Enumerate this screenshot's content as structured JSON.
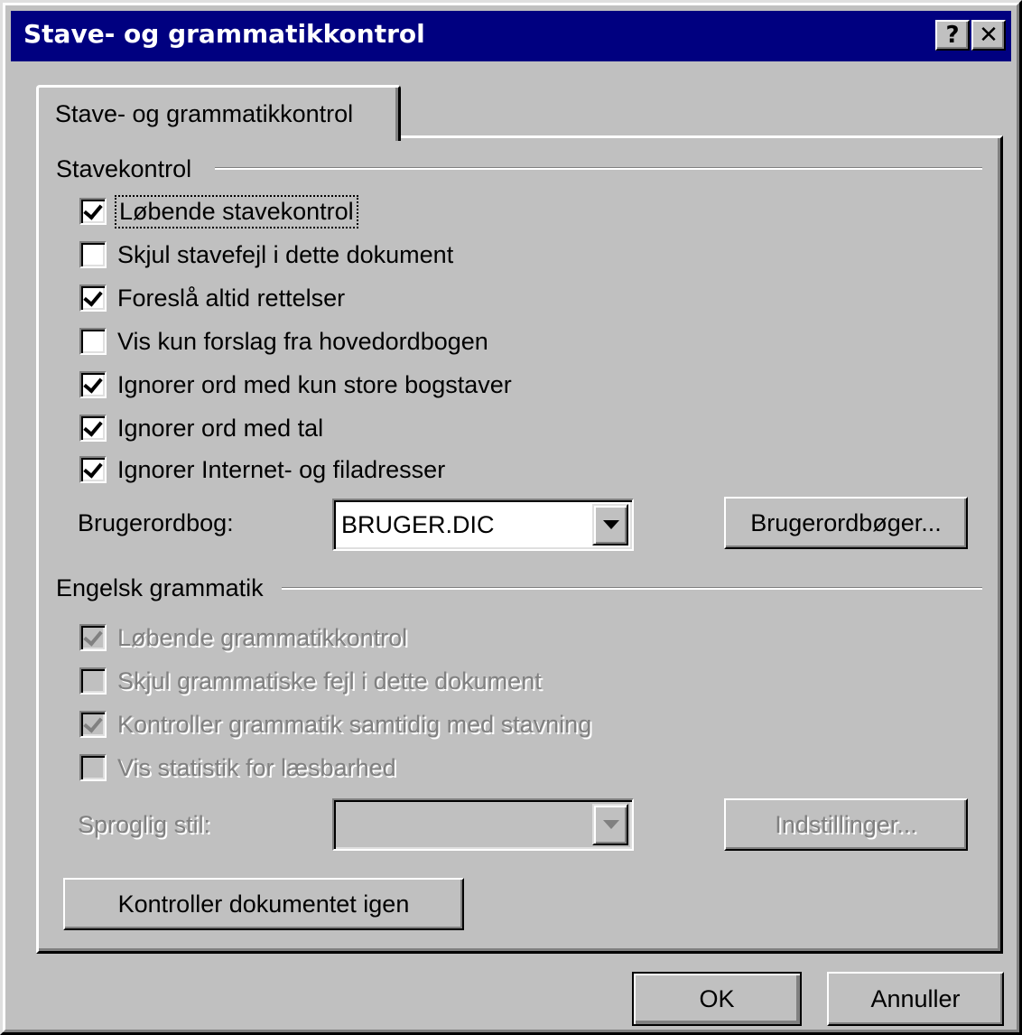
{
  "window": {
    "title": "Stave- og grammatikkontrol",
    "help_glyph": "?",
    "close_glyph": "✕"
  },
  "tab": {
    "label": "Stave- og grammatikkontrol"
  },
  "spelling": {
    "group_label": "Stavekontrol",
    "options": [
      {
        "label": "Løbende stavekontrol",
        "checked": true
      },
      {
        "label": "Skjul stavefejl i dette dokument",
        "checked": false
      },
      {
        "label": "Foreslå altid rettelser",
        "checked": true
      },
      {
        "label": "Vis kun forslag fra hovedordbogen",
        "checked": false
      },
      {
        "label": "Ignorer ord med kun store bogstaver",
        "checked": true
      },
      {
        "label": "Ignorer ord med tal",
        "checked": true
      },
      {
        "label": "Ignorer Internet- og filadresser",
        "checked": true
      }
    ],
    "dictionary_label": "Brugerordbog:",
    "dictionary_value": "BRUGER.DIC",
    "dictionaries_button": "Brugerordbøger..."
  },
  "grammar": {
    "group_label": "Engelsk grammatik",
    "options": [
      {
        "label": "Løbende grammatikkontrol",
        "checked": true,
        "enabled": false
      },
      {
        "label": "Skjul grammatiske fejl i dette dokument",
        "checked": false,
        "enabled": false
      },
      {
        "label": "Kontroller grammatik samtidig med stavning",
        "checked": true,
        "enabled": false
      },
      {
        "label": "Vis statistik for læsbarhed",
        "checked": false,
        "enabled": false
      }
    ],
    "style_label": "Sproglig stil:",
    "style_value": "",
    "settings_button": "Indstillinger..."
  },
  "recheck_button": "Kontroller dokumentet igen",
  "footer": {
    "ok_label": "OK",
    "cancel_label": "Annuller"
  }
}
